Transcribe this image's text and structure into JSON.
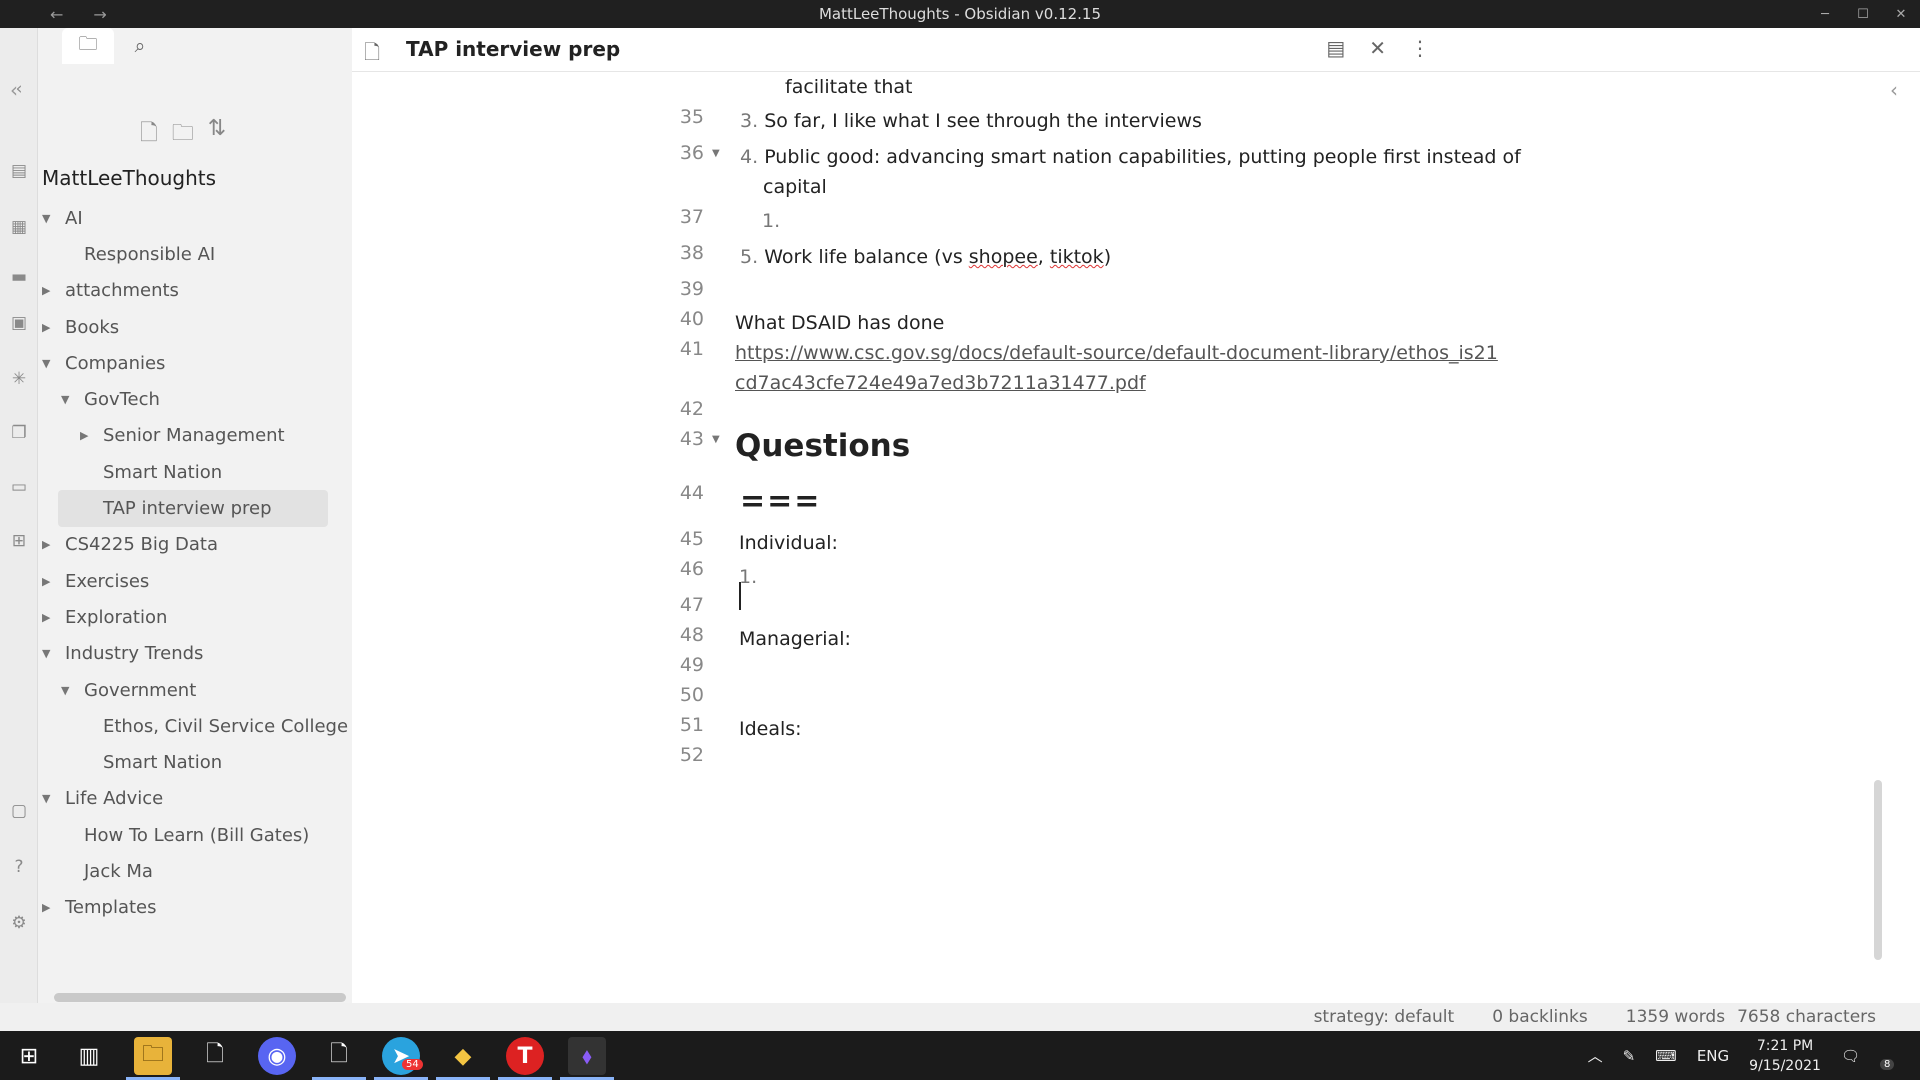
{
  "window": {
    "title": "MattLeeThoughts - Obsidian v0.12.15"
  },
  "sidebar": {
    "vault_name": "MattLeeThoughts",
    "tree": [
      {
        "label": "AI",
        "level": 0,
        "arrow": "down"
      },
      {
        "label": "Responsible AI",
        "level": 1,
        "arrow": ""
      },
      {
        "label": "attachments",
        "level": 0,
        "arrow": "right"
      },
      {
        "label": "Books",
        "level": 0,
        "arrow": "right"
      },
      {
        "label": "Companies",
        "level": 0,
        "arrow": "down"
      },
      {
        "label": "GovTech",
        "level": 1,
        "arrow": "down"
      },
      {
        "label": "Senior Management",
        "level": 2,
        "arrow": "right"
      },
      {
        "label": "Smart Nation",
        "level": 2,
        "arrow": ""
      },
      {
        "label": "TAP interview prep",
        "level": 2,
        "arrow": "",
        "active": true
      },
      {
        "label": "CS4225 Big Data",
        "level": 0,
        "arrow": "right"
      },
      {
        "label": "Exercises",
        "level": 0,
        "arrow": "right"
      },
      {
        "label": "Exploration",
        "level": 0,
        "arrow": "right"
      },
      {
        "label": "Industry Trends",
        "level": 0,
        "arrow": "down"
      },
      {
        "label": "Government",
        "level": 1,
        "arrow": "down"
      },
      {
        "label": "Ethos, Civil Service College",
        "level": 2,
        "arrow": ""
      },
      {
        "label": "Smart Nation",
        "level": 2,
        "arrow": ""
      },
      {
        "label": "Life Advice",
        "level": 0,
        "arrow": "down"
      },
      {
        "label": "How To Learn (Bill Gates)",
        "level": 1,
        "arrow": ""
      },
      {
        "label": "Jack Ma",
        "level": 1,
        "arrow": ""
      },
      {
        "label": "Templates",
        "level": 0,
        "arrow": "right"
      }
    ]
  },
  "editor": {
    "title": "TAP interview prep",
    "lines": {
      "l34b": "facilitate that",
      "l35_num": "3.",
      "l35": "So far, I like what I see through the interviews",
      "l36_num": "4.",
      "l36a": "Public good: advancing smart nation capabilities, putting people first instead of",
      "l36b": "capital",
      "l37_num": "1.",
      "l38_num": "5.",
      "l38_pre": "Work life balance (vs ",
      "l38_w1": "shopee",
      "l38_mid": ", ",
      "l38_w2": "tiktok",
      "l38_post": ")",
      "l40": "What DSAID has done",
      "l41a": "https://www.csc.gov.sg/docs/default-source/default-document-library/ethos_is21",
      "l41b": "cd7ac43cfe724e49a7ed3b7211a31477.pdf",
      "l43": "Questions",
      "l44": "===",
      "l45": "Individual:",
      "l46_num": "1.",
      "l48": "Managerial:",
      "l51": "Ideals:"
    },
    "line_numbers": [
      "35",
      "36",
      "37",
      "38",
      "39",
      "40",
      "41",
      "42",
      "43",
      "44",
      "45",
      "46",
      "47",
      "48",
      "49",
      "50",
      "51",
      "52"
    ]
  },
  "status": {
    "strategy": "strategy: default",
    "backlinks": "0 backlinks",
    "words": "1359 words",
    "characters": "7658 characters"
  },
  "taskbar": {
    "lang": "ENG",
    "time": "7:21 PM",
    "date": "9/15/2021",
    "telegram_badge": "54",
    "notif_badge": "8"
  }
}
